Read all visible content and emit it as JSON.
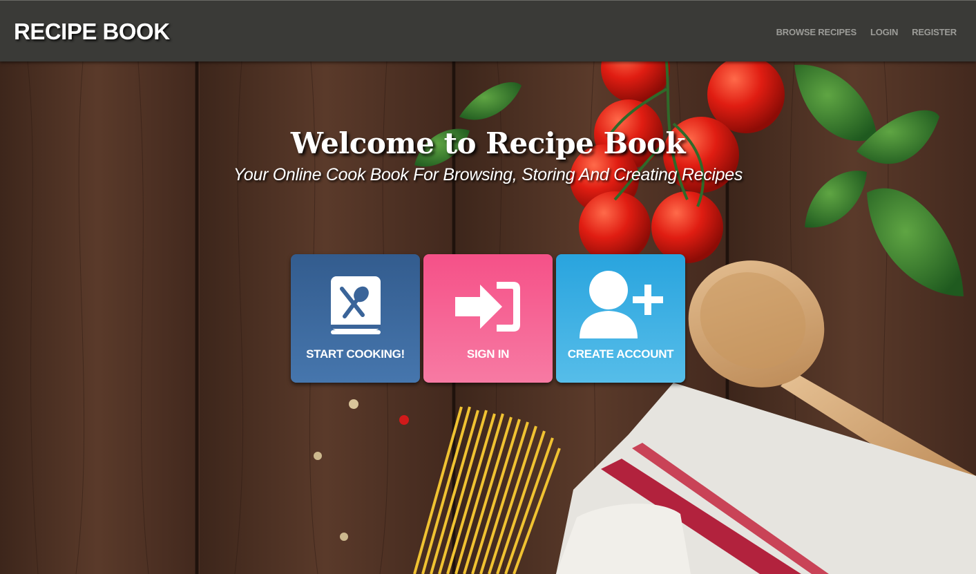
{
  "navbar": {
    "brand": "RECIPE BOOK",
    "links": [
      "BROWSE RECIPES",
      "LOGIN",
      "REGISTER"
    ]
  },
  "hero": {
    "title": "Welcome to Recipe Book",
    "subtitle": "Your Online Cook Book For Browsing, Storing And Creating Recipes"
  },
  "tiles": [
    {
      "label": "START COOKING!",
      "icon": "recipe-book-icon",
      "color": "#3a6499"
    },
    {
      "label": "SIGN IN",
      "icon": "sign-in-icon",
      "color": "#f55f8f"
    },
    {
      "label": "CREATE ACCOUNT",
      "icon": "add-user-icon",
      "color": "#33aee2"
    }
  ],
  "colors": {
    "navbar": "#3a3a37",
    "nav_link": "#9c9c98",
    "wood": "#4a2f22"
  }
}
